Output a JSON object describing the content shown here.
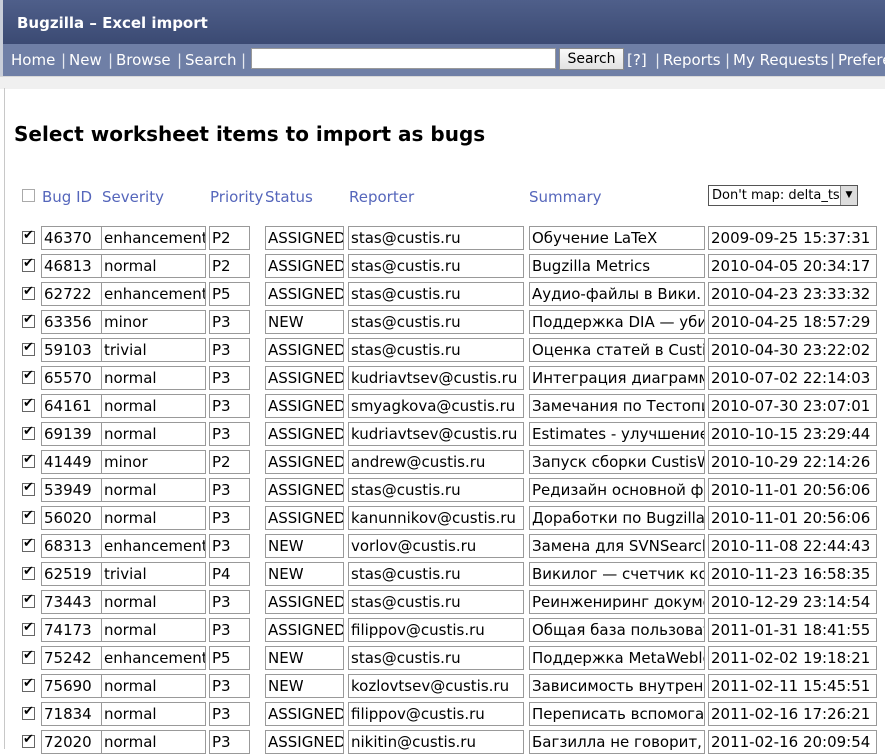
{
  "window": {
    "title": "Bugzilla – Excel import"
  },
  "nav": {
    "links": [
      "Home",
      "New",
      "Browse",
      "Search"
    ],
    "search_value": "",
    "search_button": "Search",
    "help": "[?]",
    "links_right": [
      "Reports",
      "My Requests",
      "Preferences"
    ]
  },
  "page": {
    "heading": "Select worksheet items to import as bugs"
  },
  "table": {
    "headers": {
      "bug_id": "Bug ID",
      "severity": "Severity",
      "priority": "Priority",
      "status": "Status",
      "reporter": "Reporter",
      "summary": "Summary"
    },
    "map_select": "Don't map: delta_ts",
    "rows": [
      {
        "id": "46370",
        "severity": "enhancement",
        "priority": "P2",
        "status": "ASSIGNED",
        "reporter": "stas@custis.ru",
        "summary": "Обучение LaTeX",
        "ts": "2009-09-25 15:37:31"
      },
      {
        "id": "46813",
        "severity": "normal",
        "priority": "P2",
        "status": "ASSIGNED",
        "reporter": "stas@custis.ru",
        "summary": "Bugzilla Metrics",
        "ts": "2010-04-05 20:34:17"
      },
      {
        "id": "62722",
        "severity": "enhancement",
        "priority": "P5",
        "status": "ASSIGNED",
        "reporter": "stas@custis.ru",
        "summary": "Аудио-файлы в Вики. Сделать",
        "ts": "2010-04-23 23:33:32"
      },
      {
        "id": "63356",
        "severity": "minor",
        "priority": "P3",
        "status": "NEW",
        "reporter": "stas@custis.ru",
        "summary": "Поддержка DIA — убить Visio",
        "ts": "2010-04-25 18:57:29"
      },
      {
        "id": "59103",
        "severity": "trivial",
        "priority": "P3",
        "status": "ASSIGNED",
        "reporter": "stas@custis.ru",
        "summary": "Оценка статей в CustisWiki",
        "ts": "2010-04-30 23:22:02"
      },
      {
        "id": "65570",
        "severity": "normal",
        "priority": "P3",
        "status": "ASSIGNED",
        "reporter": "kudriavtsev@custis.ru",
        "summary": "Интеграция диаграмм Visio",
        "ts": "2010-07-02 22:14:03"
      },
      {
        "id": "64161",
        "severity": "normal",
        "priority": "P3",
        "status": "ASSIGNED",
        "reporter": "smyagkova@custis.ru",
        "summary": "Замечания по Тестопиксу",
        "ts": "2010-07-30 23:07:01"
      },
      {
        "id": "69139",
        "severity": "normal",
        "priority": "P3",
        "status": "ASSIGNED",
        "reporter": "kudriavtsev@custis.ru",
        "summary": "Estimates - улучшение отчёта",
        "ts": "2010-10-15 23:29:44"
      },
      {
        "id": "41449",
        "severity": "minor",
        "priority": "P2",
        "status": "ASSIGNED",
        "reporter": "andrew@custis.ru",
        "summary": "Запуск сборки CustisWiki",
        "ts": "2010-10-29 22:14:26"
      },
      {
        "id": "53949",
        "severity": "normal",
        "priority": "P3",
        "status": "ASSIGNED",
        "reporter": "stas@custis.ru",
        "summary": "Редизайн основной формы",
        "ts": "2010-11-01 20:56:06"
      },
      {
        "id": "56020",
        "severity": "normal",
        "priority": "P3",
        "status": "ASSIGNED",
        "reporter": "kanunnikov@custis.ru",
        "summary": "Доработки по Bugzilla и Вики",
        "ts": "2010-11-01 20:56:06"
      },
      {
        "id": "68313",
        "severity": "enhancement",
        "priority": "P3",
        "status": "NEW",
        "reporter": "vorlov@custis.ru",
        "summary": "Замена для SVNSearch",
        "ts": "2010-11-08 22:44:43"
      },
      {
        "id": "62519",
        "severity": "trivial",
        "priority": "P4",
        "status": "NEW",
        "reporter": "stas@custis.ru",
        "summary": "Викилог — счетчик коммитов",
        "ts": "2010-11-23 16:58:35"
      },
      {
        "id": "73443",
        "severity": "normal",
        "priority": "P3",
        "status": "ASSIGNED",
        "reporter": "stas@custis.ru",
        "summary": "Реинжениринг документации",
        "ts": "2010-12-29 23:14:54"
      },
      {
        "id": "74173",
        "severity": "normal",
        "priority": "P3",
        "status": "ASSIGNED",
        "reporter": "filippov@custis.ru",
        "summary": "Общая база пользователей",
        "ts": "2011-01-31 18:41:55"
      },
      {
        "id": "75242",
        "severity": "enhancement",
        "priority": "P5",
        "status": "NEW",
        "reporter": "stas@custis.ru",
        "summary": "Поддержка MetaWeblog API",
        "ts": "2011-02-02 19:18:21"
      },
      {
        "id": "75690",
        "severity": "normal",
        "priority": "P3",
        "status": "NEW",
        "reporter": "kozlovtsev@custis.ru",
        "summary": "Зависимость внутренних",
        "ts": "2011-02-11 15:45:51"
      },
      {
        "id": "71834",
        "severity": "normal",
        "priority": "P3",
        "status": "ASSIGNED",
        "reporter": "filippov@custis.ru",
        "summary": "Переписать вспомогательные",
        "ts": "2011-02-16 17:26:21"
      },
      {
        "id": "72020",
        "severity": "normal",
        "priority": "P3",
        "status": "ASSIGNED",
        "reporter": "nikitin@custis.ru",
        "summary": "Багзилла не говорит, кто",
        "ts": "2011-02-16 20:09:54"
      }
    ]
  }
}
